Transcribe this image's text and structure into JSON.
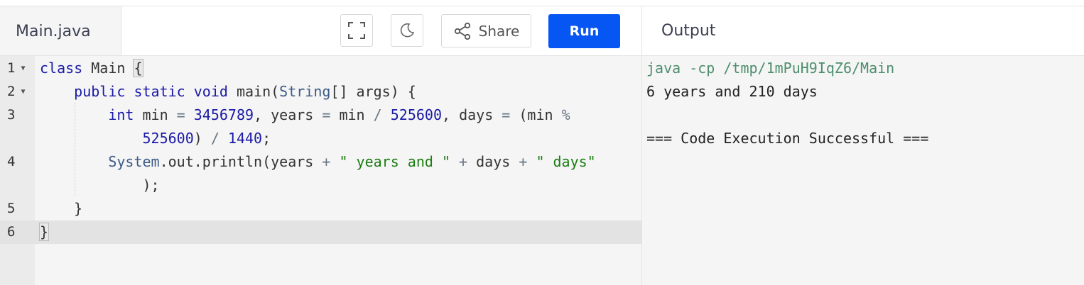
{
  "editor": {
    "file_tab": "Main.java",
    "share_label": "Share",
    "run_label": "Run",
    "line_numbers": [
      "1",
      "2",
      "3",
      "",
      "4",
      "",
      "5",
      "6"
    ],
    "code": {
      "l1": {
        "kw": "class",
        "name": " Main ",
        "brace": "{"
      },
      "l2": {
        "indent": "    ",
        "kw": "public static void",
        "rest": " main(",
        "type": "String",
        "rest2": "[] args) {"
      },
      "l3": {
        "indent": "        ",
        "kw": "int",
        "a": " min ",
        "op1": "=",
        "b": " ",
        "n1": "3456789",
        "c": ", years ",
        "op2": "=",
        "d": " min ",
        "op3": "/",
        "e": " ",
        "n2": "525600",
        "f": ", days ",
        "op4": "=",
        "g": " (min ",
        "op5": "%"
      },
      "l3b": {
        "indent": "            ",
        "n1": "525600",
        "a": ") ",
        "op": "/",
        "b": " ",
        "n2": "1440",
        "c": ";"
      },
      "l4": {
        "indent": "        ",
        "type": "System",
        "a": ".out.println(years ",
        "op1": "+",
        "b": " ",
        "s1": "\" years and \"",
        "c": " ",
        "op2": "+",
        "d": " days ",
        "op3": "+",
        "e": " ",
        "s2": "\" days\""
      },
      "l4b": {
        "text": "            );"
      },
      "l5": {
        "text": "    }"
      },
      "l6": {
        "brace": "}"
      }
    }
  },
  "output": {
    "title": "Output",
    "lines": [
      "java -cp /tmp/1mPuH9IqZ6/Main",
      "6 years and 210 days",
      "",
      "=== Code Execution Successful ==="
    ]
  },
  "colors": {
    "run_button": "#0556f3"
  }
}
